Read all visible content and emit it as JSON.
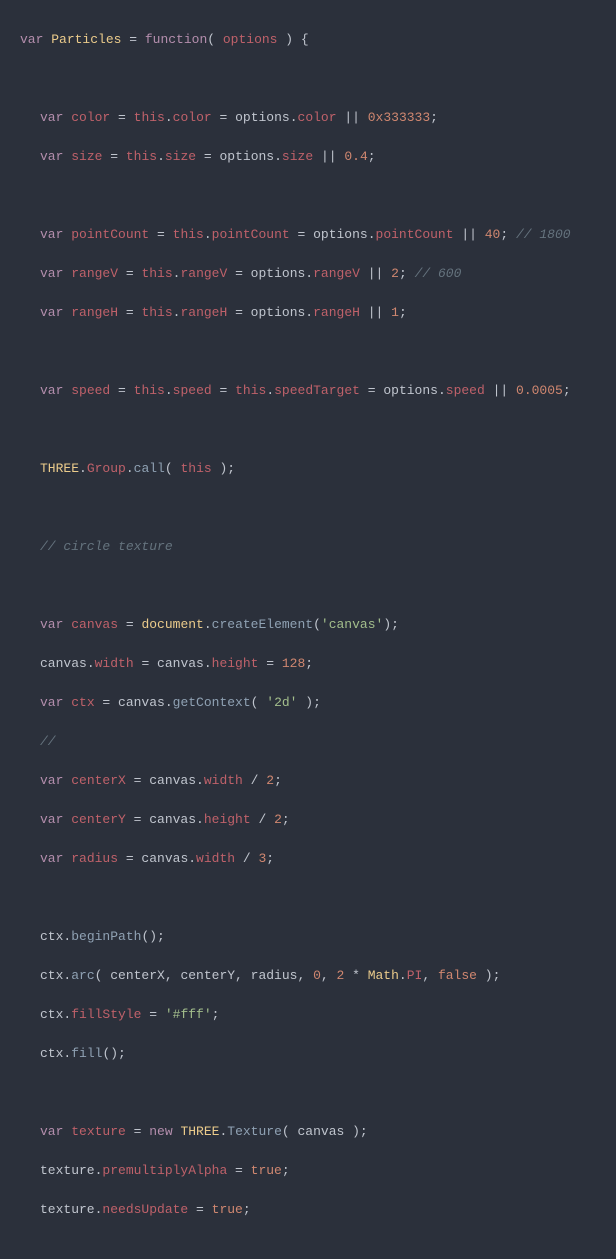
{
  "code": {
    "l0": {
      "var": "var",
      "name": "Particles",
      "eq": " = ",
      "fn": "function",
      "paren": "( ",
      "arg": "options",
      "paren2": " ) {"
    },
    "l2": {
      "var": "var",
      "name": "color",
      "eq": " = ",
      "this": "this",
      "dot": ".",
      "prop": "color",
      "asgn": " = options.",
      "field": "color",
      "or": " || ",
      "val": "0x333333",
      "semi": ";"
    },
    "l3": {
      "var": "var",
      "name": "size",
      "eq": " = ",
      "this": "this",
      "dot": ".",
      "prop": "size",
      "asgn": " = options.",
      "field": "size",
      "or": " || ",
      "val": "0.4",
      "semi": ";"
    },
    "l5": {
      "var": "var",
      "name": "pointCount",
      "eq": " = ",
      "this": "this",
      "dot": ".",
      "prop": "pointCount",
      "asgn": " = options.",
      "field": "pointCount",
      "or": " || ",
      "val": "40",
      "semi": "; ",
      "com": "// 1800"
    },
    "l6": {
      "var": "var",
      "name": "rangeV",
      "eq": " = ",
      "this": "this",
      "dot": ".",
      "prop": "rangeV",
      "asgn": " = options.",
      "field": "rangeV",
      "or": " || ",
      "val": "2",
      "semi": "; ",
      "com": "// 600"
    },
    "l7": {
      "var": "var",
      "name": "rangeH",
      "eq": " = ",
      "this": "this",
      "dot": ".",
      "prop": "rangeH",
      "asgn": " = options.",
      "field": "rangeH",
      "or": " || ",
      "val": "1",
      "semi": ";"
    },
    "l9": {
      "var": "var",
      "name": "speed",
      "eq": " = ",
      "this": "this",
      "dot": ".",
      "prop": "speed",
      "asgn2": " = ",
      "this2": "this",
      "dot2": ".",
      "prop2": "speedTarget",
      "asgn3": " = options.",
      "field": "speed",
      "or": " || ",
      "val": "0.0005",
      "semi": ";"
    },
    "l11": {
      "klass": "THREE",
      "dot": ".",
      "sub": "Group",
      "dot2": ".",
      "call": "call",
      "paren": "( ",
      "this": "this",
      "paren2": " );"
    },
    "l13": {
      "com": "// circle texture"
    },
    "l15": {
      "var": "var",
      "name": "canvas",
      "eq": " = ",
      "doc": "document",
      "dot": ".",
      "call": "createElement",
      "paren": "(",
      "str": "'canvas'",
      "paren2": ");"
    },
    "l16": {
      "obj": "canvas",
      "dot": ".",
      "prop": "width",
      "asgn": " = canvas.",
      "prop2": "height",
      "asgn2": " = ",
      "val": "128",
      "semi": ";"
    },
    "l17": {
      "var": "var",
      "name": "ctx",
      "eq": " = canvas.",
      "call": "getContext",
      "paren": "( ",
      "str": "'2d'",
      "paren2": " );"
    },
    "l18": {
      "com": "//"
    },
    "l19": {
      "var": "var",
      "name": "centerX",
      "eq": " = canvas.",
      "prop": "width",
      "op": " / ",
      "val": "2",
      "semi": ";"
    },
    "l20": {
      "var": "var",
      "name": "centerY",
      "eq": " = canvas.",
      "prop": "height",
      "op": " / ",
      "val": "2",
      "semi": ";"
    },
    "l21": {
      "var": "var",
      "name": "radius",
      "eq": " = canvas.",
      "prop": "width",
      "op": " / ",
      "val": "3",
      "semi": ";"
    },
    "l23": {
      "obj": "ctx",
      "dot": ".",
      "call": "beginPath",
      "paren": "();"
    },
    "l24": {
      "obj": "ctx",
      "dot": ".",
      "call": "arc",
      "paren": "( centerX, centerY, radius, ",
      "zero": "0",
      "com1": ", ",
      "two": "2",
      "mul": " * ",
      "klass": "Math",
      "dot2": ".",
      "pi": "PI",
      "com2": ", ",
      "false": "false",
      "paren2": " );"
    },
    "l25": {
      "obj": "ctx",
      "dot": ".",
      "prop": "fillStyle",
      "asgn": " = ",
      "str": "'#fff'",
      "semi": ";"
    },
    "l26": {
      "obj": "ctx",
      "dot": ".",
      "call": "fill",
      "paren": "();"
    },
    "l28": {
      "var": "var",
      "name": "texture",
      "eq": " = ",
      "new": "new",
      "sp": " ",
      "klass": "THREE",
      "dot": ".",
      "call": "Texture",
      "paren": "( canvas );"
    },
    "l29": {
      "obj": "texture",
      "dot": ".",
      "prop": "premultiplyAlpha",
      "asgn": " = ",
      "val": "true",
      "semi": ";"
    },
    "l30": {
      "obj": "texture",
      "dot": ".",
      "prop": "needsUpdate",
      "asgn": " = ",
      "val": "true",
      "semi": ";"
    }
  }
}
